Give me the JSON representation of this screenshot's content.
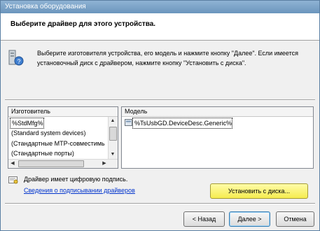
{
  "window": {
    "title": "Установка оборудования"
  },
  "header": {
    "title": "Выберите драйвер для этого устройства."
  },
  "instructions": {
    "line1": "Выберите изготовителя устройства, его модель и нажмите кнопку \"Далее\". Если имеется",
    "line2": "установочный диск с драйвером, нажмите кнопку \"Установить с диска\"."
  },
  "manufacturers": {
    "header": "Изготовитель",
    "items": [
      "%StdMfg%",
      "(Standard system devices)",
      "(Стандартные МТР-совместимь",
      "(Стандартные порты)"
    ]
  },
  "models": {
    "header": "Модель",
    "items": [
      "%TsUsbGD.DeviceDesc.Generic%"
    ]
  },
  "signature": {
    "text": "Драйвер имеет цифровую подпись.",
    "link": "Сведения о подписывании драйверов"
  },
  "buttons": {
    "have_disk": "Установить с диска...",
    "back": "< Назад",
    "next": "Далее >",
    "cancel": "Отмена"
  },
  "colors": {
    "highlight": "#f5ec4f",
    "link": "#0033cc"
  }
}
